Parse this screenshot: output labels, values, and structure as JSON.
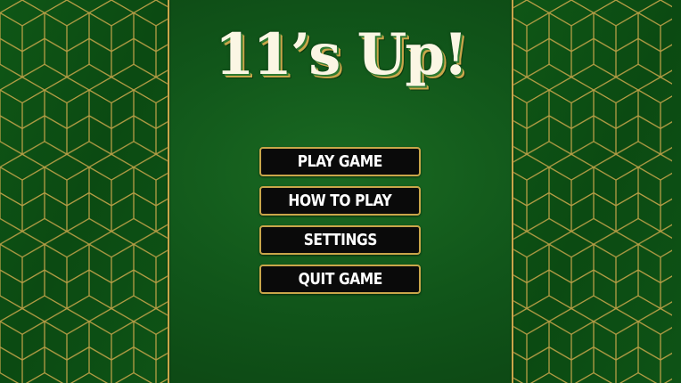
{
  "game": {
    "title": "11’s Up!"
  },
  "menu": {
    "items": [
      {
        "label": "PLAY GAME"
      },
      {
        "label": "HOW TO PLAY"
      },
      {
        "label": "SETTINGS"
      },
      {
        "label": "QUIT GAME"
      }
    ]
  },
  "colors": {
    "background": "#11561a",
    "panel": "#0e4d14",
    "gold": "#c9a64a",
    "button": "#0a0a0a",
    "button_text": "#ffffff",
    "title_text": "#fbf6e4"
  }
}
